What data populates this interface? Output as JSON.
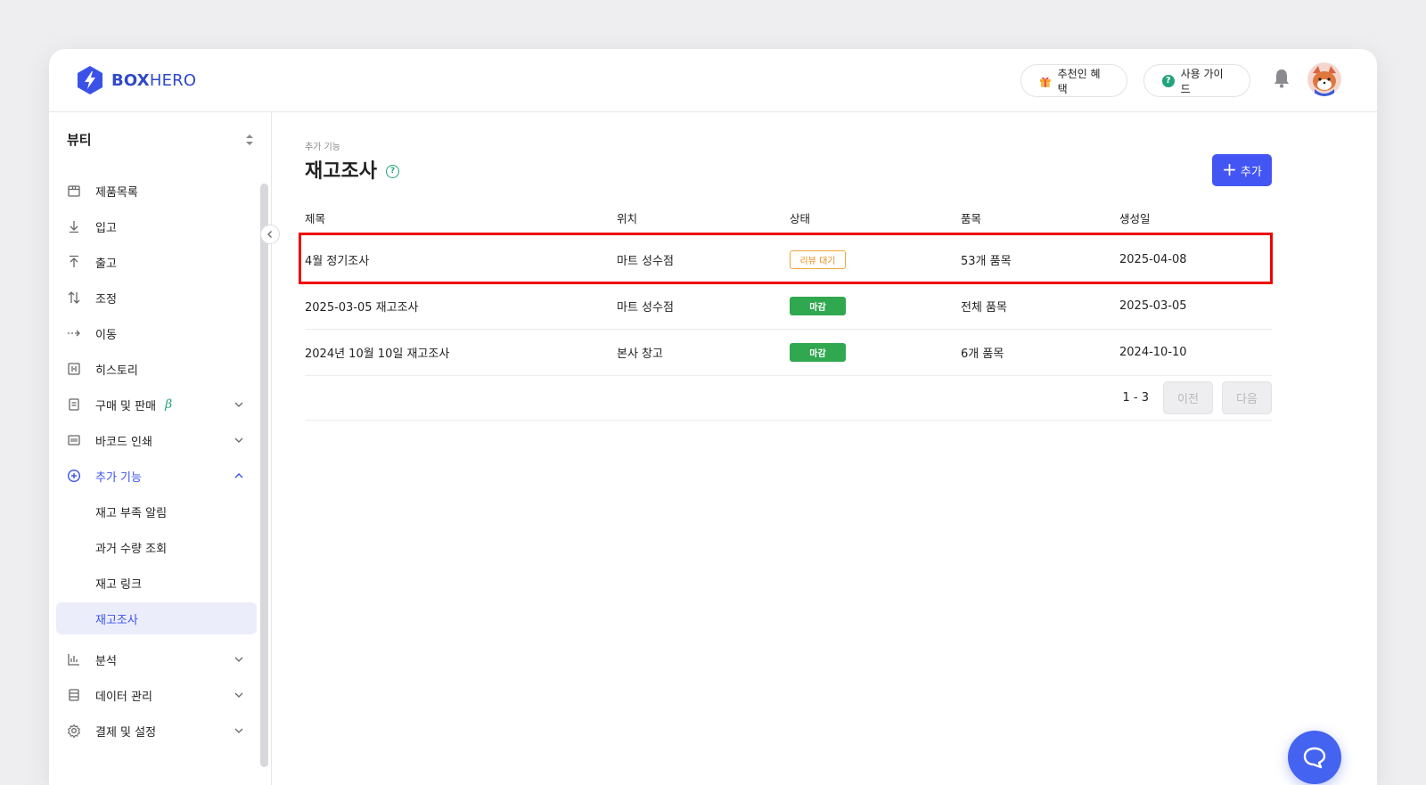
{
  "brand": {
    "name_bold": "BOX",
    "name_light": "HERO"
  },
  "header": {
    "referral_label": "추천인 혜택",
    "guide_label": "사용 가이드",
    "guide_icon_text": "?"
  },
  "sidebar": {
    "workspace": "뷰티",
    "items": [
      {
        "label": "제품목록",
        "icon": "box-icon"
      },
      {
        "label": "입고",
        "icon": "arrow-down-icon"
      },
      {
        "label": "출고",
        "icon": "arrow-up-icon"
      },
      {
        "label": "조정",
        "icon": "adjust-icon"
      },
      {
        "label": "이동",
        "icon": "move-icon"
      },
      {
        "label": "히스토리",
        "icon": "history-icon"
      },
      {
        "label": "구매 및 판매",
        "icon": "document-icon",
        "beta": "β"
      },
      {
        "label": "바코드 인쇄",
        "icon": "barcode-icon"
      },
      {
        "label": "추가 기능",
        "icon": "plus-circle-icon"
      },
      {
        "label": "재고 부족 알림"
      },
      {
        "label": "과거 수량 조회"
      },
      {
        "label": "재고 링크"
      },
      {
        "label": "재고조사"
      },
      {
        "label": "분석",
        "icon": "chart-icon"
      },
      {
        "label": "데이터 관리",
        "icon": "database-icon"
      },
      {
        "label": "결제 및 설정",
        "icon": "gear-icon"
      }
    ]
  },
  "page": {
    "breadcrumb": "추가 기능",
    "title": "재고조사",
    "help_text": "?",
    "add_label": "추가",
    "add_plus": "+"
  },
  "table": {
    "columns": [
      "제목",
      "위치",
      "상태",
      "품목",
      "생성일"
    ],
    "rows": [
      {
        "title": "4월 정기조사",
        "location": "마트 성수점",
        "status": "리뷰 대기",
        "items": "53개 품목",
        "created": "2025-04-08"
      },
      {
        "title": "2025-03-05 재고조사",
        "location": "마트 성수점",
        "status": "마감",
        "items": "전체 품목",
        "created": "2025-03-05"
      },
      {
        "title": "2024년 10월 10일 재고조사",
        "location": "본사 창고",
        "status": "마감",
        "items": "6개 품목",
        "created": "2024-10-10"
      }
    ]
  },
  "pagination": {
    "range": "1 - 3",
    "prev_label": "이전",
    "next_label": "다음"
  },
  "colors": {
    "accent": "#4356f4",
    "highlight": "#e00000",
    "closed": "#2fa84f",
    "pending": "#e58c16",
    "help": "#22a37b"
  }
}
